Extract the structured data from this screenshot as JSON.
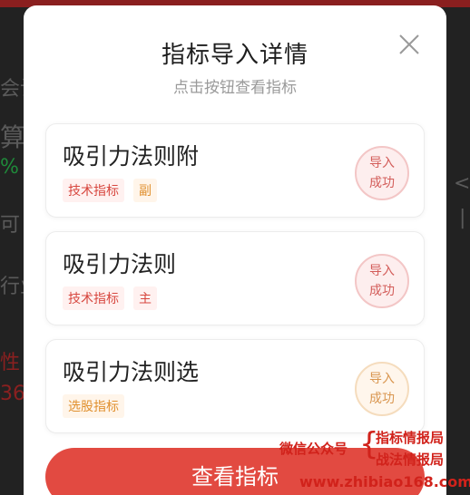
{
  "background": {
    "fragments": [
      "会计",
      "算",
      "%",
      "可",
      "行业",
      "性",
      "36",
      "<",
      "|"
    ]
  },
  "modal": {
    "title": "指标导入详情",
    "subtitle": "点击按钮查看指标",
    "close_icon": "close-icon",
    "items": [
      {
        "name": "吸引力法则附",
        "tags": [
          "技术指标",
          "副"
        ],
        "status_line1": "导入",
        "status_line2": "成功",
        "status_color": "red"
      },
      {
        "name": "吸引力法则",
        "tags": [
          "技术指标",
          "主"
        ],
        "status_line1": "导入",
        "status_line2": "成功",
        "status_color": "red"
      },
      {
        "name": "吸引力法则选",
        "tags": [
          "选股指标"
        ],
        "status_line1": "导入",
        "status_line2": "成功",
        "status_color": "orange"
      }
    ],
    "button_label": "查看指标"
  },
  "watermark": {
    "account_label": "微信公众号",
    "line1": "指标情报局",
    "line2": "战法情报局",
    "url": "www.zhibiao168.com"
  },
  "colors": {
    "accent": "#e24a41",
    "tag_red_bg": "#fff1f0",
    "tag_orange_bg": "#fff5ea"
  }
}
